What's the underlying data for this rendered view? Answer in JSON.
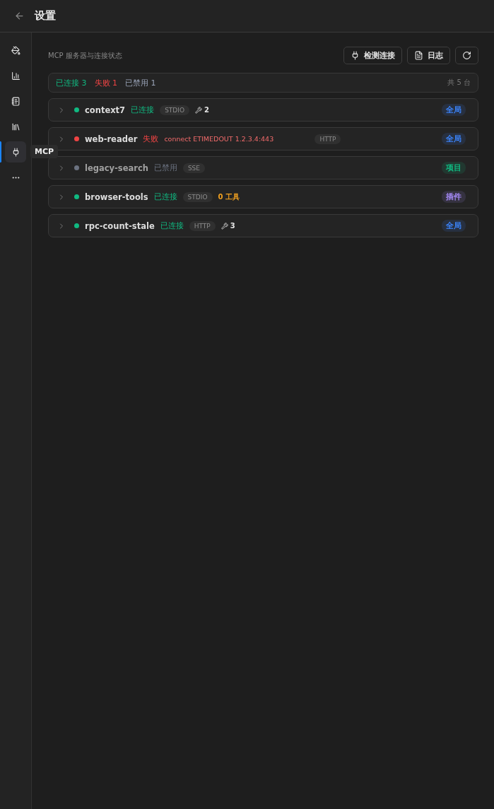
{
  "header": {
    "title": "设置"
  },
  "sidebar": {
    "items": [
      {
        "selected": false
      },
      {
        "selected": false
      },
      {
        "selected": false
      },
      {
        "selected": false
      },
      {
        "selected": true,
        "tooltip": "MCP"
      },
      {
        "selected": false
      }
    ]
  },
  "section": {
    "title": "MCP 服务器与连接状态",
    "buttons": [
      {
        "label": "检测连接"
      },
      {
        "label": "日志"
      }
    ]
  },
  "summary": {
    "items": [
      {
        "kind": "connected",
        "label": "已连接 3"
      },
      {
        "kind": "failed",
        "label": "失败 1"
      },
      {
        "kind": "disabled",
        "label": "已禁用 1"
      }
    ],
    "total": "共 5 台"
  },
  "servers": [
    {
      "name": "context7",
      "kind": "connected",
      "status_label": "已连接",
      "transport": "STDIO",
      "tools": {
        "kind": "count",
        "text": "2"
      },
      "scope": {
        "label": "全局",
        "color": "#3b82f6"
      }
    },
    {
      "name": "web-reader",
      "kind": "failed",
      "status_label": "失败",
      "error": "connect ETIMEDOUT 1.2.3.4:443",
      "transport": "HTTP",
      "scope": {
        "label": "全局",
        "color": "#3b82f6"
      }
    },
    {
      "name": "legacy-search",
      "kind": "disabled",
      "status_label": "已禁用",
      "transport": "SSE",
      "scope": {
        "label": "项目",
        "color": "#10b981"
      }
    },
    {
      "name": "browser-tools",
      "kind": "connected",
      "status_label": "已连接",
      "transport": "STDIO",
      "tools": {
        "kind": "warning",
        "text": "0 工具"
      },
      "scope": {
        "label": "插件",
        "color": "#a78bfa"
      }
    },
    {
      "name": "rpc-count-stale",
      "kind": "connected",
      "status_label": "已连接",
      "transport": "HTTP",
      "tools": {
        "kind": "count",
        "text": "3"
      },
      "scope": {
        "label": "全局",
        "color": "#3b82f6"
      }
    }
  ]
}
